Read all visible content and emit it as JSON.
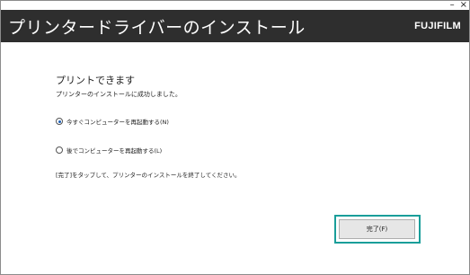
{
  "window_controls": {
    "minimize": "–",
    "close": "×"
  },
  "header": {
    "title": "プリンタードライバーのインストール",
    "brand": "FUJIFILM"
  },
  "content": {
    "heading": "プリントできます",
    "success_message": "プリンターのインストールに成功しました。",
    "options": [
      {
        "label": "今すぐコンピューターを再起動する(N)",
        "selected": true
      },
      {
        "label": "後でコンピューターを再起動する(L)",
        "selected": false
      }
    ],
    "instruction": "[完了]をタップして、プリンターのインストールを終了してください。"
  },
  "footer": {
    "finish_label": "完了(F)"
  },
  "colors": {
    "header_bg": "#2e2e2e",
    "focus_border": "#1a9e9a",
    "radio_dot": "#1b5fb8"
  }
}
